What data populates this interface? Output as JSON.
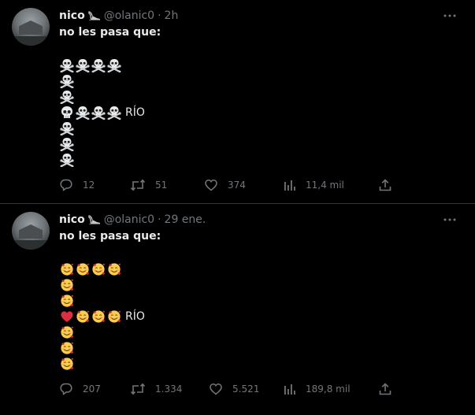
{
  "tweets": [
    {
      "author_name": "nico",
      "author_badge": "high-heel-icon",
      "handle": "@olanic0",
      "separator": "·",
      "time": "2h",
      "text": "no les pasa que:",
      "art_icon": "skull-crossbones-icon",
      "art_special_icon": "skull-icon",
      "rio_label": "RÍO",
      "stats": {
        "replies": "12",
        "retweets": "51",
        "likes": "374",
        "views": "11,4 mil"
      }
    },
    {
      "author_name": "nico",
      "author_badge": "high-heel-icon",
      "handle": "@olanic0",
      "separator": "·",
      "time": "29 ene.",
      "text": "no les pasa que:",
      "art_icon": "smiling-face-with-hearts-icon",
      "art_special_icon": "red-heart-icon",
      "rio_label": "RÍO",
      "stats": {
        "replies": "207",
        "retweets": "1.334",
        "likes": "5.521",
        "views": "189,8 mil"
      }
    }
  ],
  "colors": {
    "background": "#000000",
    "text": "#e7e9ea",
    "muted": "#71767b",
    "divider": "#2f3336",
    "heart": "#e0245e"
  }
}
